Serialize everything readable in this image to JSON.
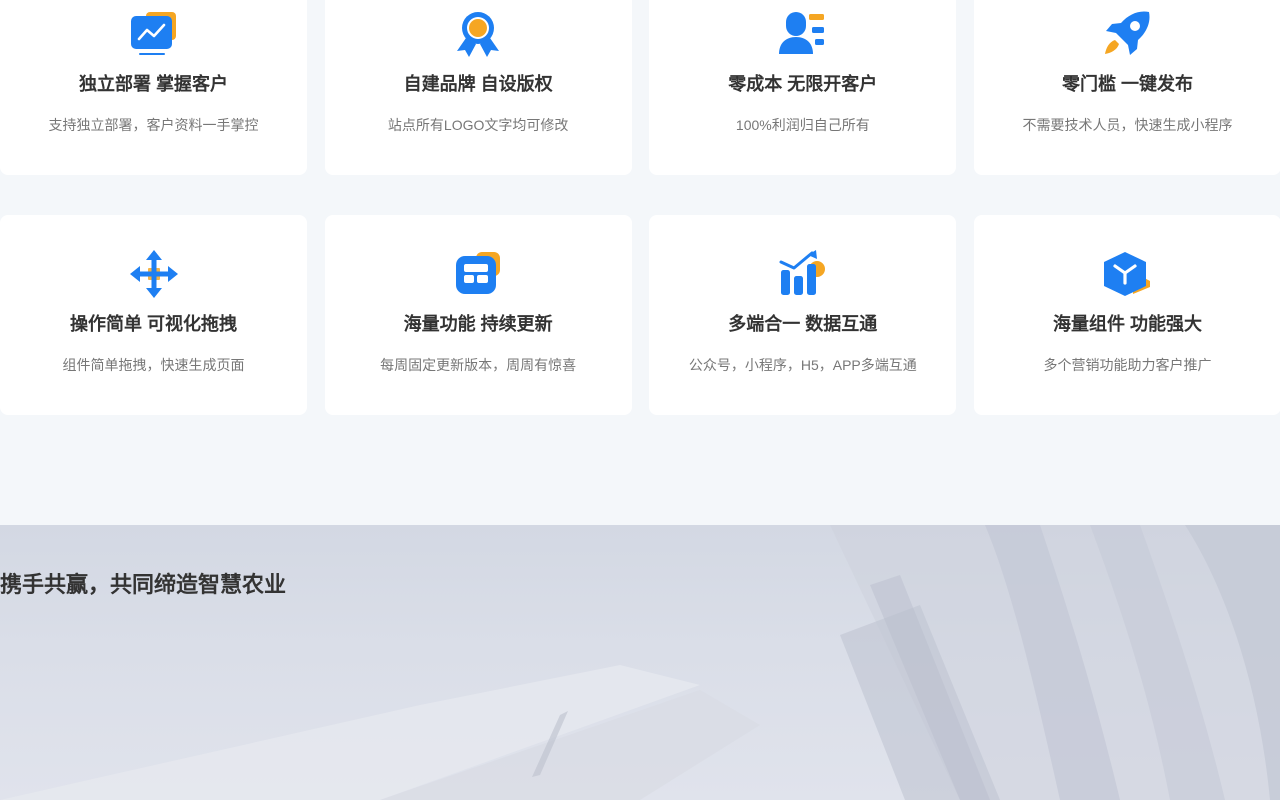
{
  "features": [
    {
      "icon": "monitor-chart-icon",
      "title": "独立部署 掌握客户",
      "desc": "支持独立部署，客户资料一手掌控"
    },
    {
      "icon": "award-badge-icon",
      "title": "自建品牌 自设版权",
      "desc": "站点所有LOGO文字均可修改"
    },
    {
      "icon": "user-profile-icon",
      "title": "零成本 无限开客户",
      "desc": "100%利润归自己所有"
    },
    {
      "icon": "rocket-icon",
      "title": "零门槛 一键发布",
      "desc": "不需要技术人员，快速生成小程序"
    },
    {
      "icon": "move-arrows-icon",
      "title": "操作简单 可视化拖拽",
      "desc": "组件简单拖拽，快速生成页面"
    },
    {
      "icon": "layout-grid-icon",
      "title": "海量功能 持续更新",
      "desc": "每周固定更新版本，周周有惊喜"
    },
    {
      "icon": "bar-chart-trend-icon",
      "title": "多端合一 数据互通",
      "desc": "公众号，小程序，H5，APP多端互通"
    },
    {
      "icon": "cube-icon",
      "title": "海量组件 功能强大",
      "desc": "多个营销功能助力客户推广"
    }
  ],
  "banner": {
    "slogan": "携手共赢，共同缔造智慧农业"
  },
  "colors": {
    "primary_blue": "#1e7ff2",
    "accent_orange": "#f5a623",
    "card_bg": "#ffffff",
    "page_bg": "#f4f7fa",
    "title_text": "#333333",
    "desc_text": "#777777"
  }
}
